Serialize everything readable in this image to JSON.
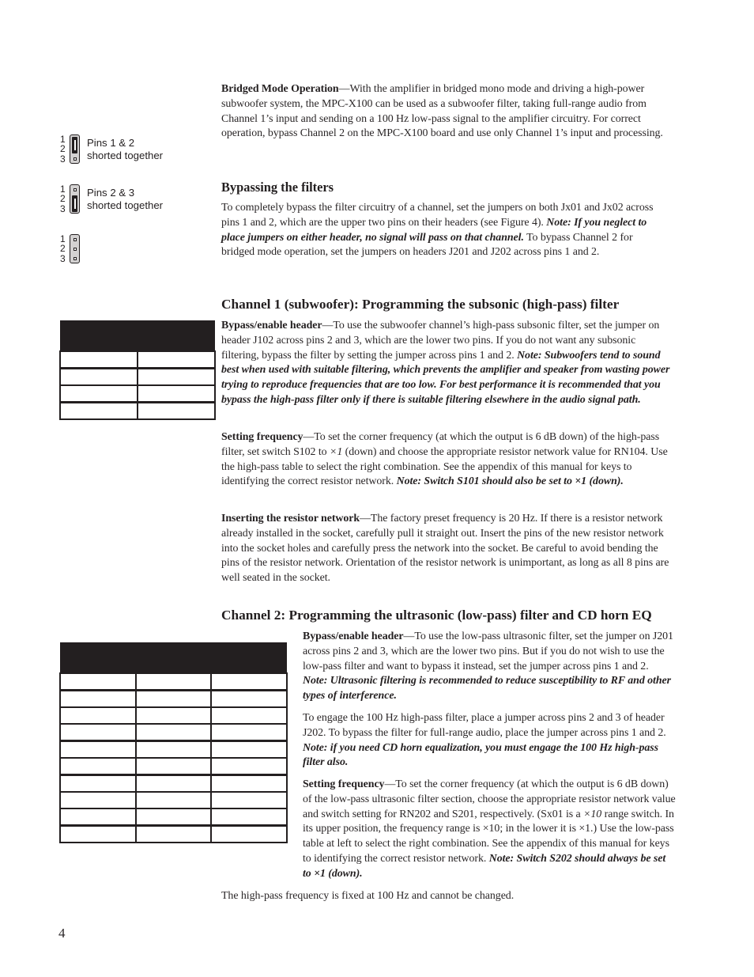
{
  "page_number": "4",
  "bridged": {
    "lead": "Bridged Mode Operation",
    "text": "—With the amplifier in bridged mono mode and driving a high-power subwoofer system, the MPC-X100 can be used as a subwoofer filter, taking full-range audio from Channel 1’s input and sending on a 100 Hz low-pass signal to the amplifier circuitry. For correct operation, bypass Channel 2 on the MPC-X100 board and use only Channel 1’s input and processing."
  },
  "jumper_figures": [
    {
      "pins": [
        "1",
        "2",
        "3"
      ],
      "shorted": "1-2",
      "label_line1": "Pins 1 & 2",
      "label_line2": "shorted together"
    },
    {
      "pins": [
        "1",
        "2",
        "3"
      ],
      "shorted": "2-3",
      "label_line1": "Pins 2 & 3",
      "label_line2": "shorted together"
    },
    {
      "pins": [
        "1",
        "2",
        "3"
      ],
      "shorted": "none",
      "label_line1": "",
      "label_line2": ""
    }
  ],
  "bypassing": {
    "heading": "Bypassing the filters",
    "text1": "To completely bypass the filter circuitry of a channel, set the jumpers on both Jx01 and Jx02 across pins 1 and 2, which are the upper two pins on their headers (see Figure 4). ",
    "note": "Note: If you neglect to place jumpers on either header, no signal will pass on that channel.",
    "text2": " To bypass Channel 2 for bridged mode operation, set the jumpers on headers J201 and J202 across pins 1 and 2."
  },
  "channel1": {
    "heading": "Channel 1 (subwoofer): Programming the subsonic (high-pass) filter",
    "bypass": {
      "lead": "Bypass/enable header",
      "text": "—To use the subwoofer channel’s high-pass subsonic filter, set the jumper on header J102 across pins 2 and 3, which are the lower two pins. If you do not want any subsonic filtering, bypass the filter by setting the jumper across pins 1 and 2. ",
      "note": "Note: Subwoofers tend to sound best when used with suitable filtering, which prevents the amplifier and speaker from wasting power trying to reproduce frequencies that are too low. For best performance it is recommended that you bypass the high-pass filter only if there is suitable filtering elsewhere in the audio signal path."
    },
    "frequency": {
      "lead": "Setting frequency",
      "text1": "—To set the corner frequency (at which the output is 6 dB down) of the high-pass filter, set switch S102 to ",
      "x1": "×1",
      "text2": " (down) and choose the appropriate resistor network value for RN104. Use the high-pass table to select the right combination. See the appendix of this manual for keys to identifying the correct resistor network. ",
      "note": "Note: Switch S101 should also be set to ×1 (down)."
    },
    "inserting": {
      "lead": "Inserting the resistor network",
      "text": "—The factory preset frequency is 20 Hz. If there is a resistor network already installed in the socket, carefully pull it straight out. Insert the pins of the new resistor network into the socket holes and carefully press the network into the socket. Be careful to avoid bending the pins of the resistor network. Orientation of the resistor network is unimportant, as long as all 8 pins are well seated in the socket."
    },
    "table": {
      "columns": 2,
      "header": [
        "",
        ""
      ],
      "rows": [
        [
          "",
          ""
        ],
        [
          "",
          ""
        ],
        [
          "",
          ""
        ],
        [
          "",
          ""
        ]
      ]
    }
  },
  "channel2": {
    "heading": "Channel 2: Programming the ultrasonic (low-pass) filter and CD horn EQ",
    "bypass": {
      "lead": "Bypass/enable header",
      "text": "—To use the low-pass ultrasonic filter, set the jumper on J201 across pins 2 and 3, which are the lower two pins. But if you do not wish to use the low-pass filter and want to bypass it instead, set the jumper across pins 1 and 2. ",
      "note": "Note: Ultrasonic filtering is recommended to reduce susceptibility to RF and other types of interference."
    },
    "engage": {
      "text": "To engage the 100 Hz high-pass filter, place a jumper across pins 2 and 3 of header J202. To bypass the filter for full-range audio, place the jumper across pins 1 and 2. ",
      "note": "Note: if you need CD horn equalization, you must engage the 100 Hz high-pass filter also."
    },
    "frequency": {
      "lead": "Setting frequency",
      "text1": "—To set the corner frequency (at which the output is 6 dB down) of the low-pass ultrasonic filter section, choose the appropriate resistor network value and switch setting for RN202 and S201, respectively. (Sx01 is a ",
      "x10": "×10",
      "text2": " range switch. In its upper position, the frequency range is ×10; in the lower it is ×1.) Use the low-pass table at left to select the right combination. See the appendix of this manual for keys to identifying the correct resistor network. ",
      "note": "Note: Switch S202 should always be set to ×1 (down)."
    },
    "fixed": "The high-pass frequency is fixed at 100 Hz and cannot be changed.",
    "table": {
      "columns": 3,
      "header": [
        "",
        "",
        ""
      ],
      "rows": [
        [
          "",
          "",
          ""
        ],
        [
          "",
          "",
          ""
        ],
        [
          "",
          "",
          ""
        ],
        [
          "",
          "",
          ""
        ],
        [
          "",
          "",
          ""
        ],
        [
          "",
          "",
          ""
        ],
        [
          "",
          "",
          ""
        ],
        [
          "",
          "",
          ""
        ],
        [
          "",
          "",
          ""
        ],
        [
          "",
          "",
          ""
        ]
      ]
    }
  }
}
